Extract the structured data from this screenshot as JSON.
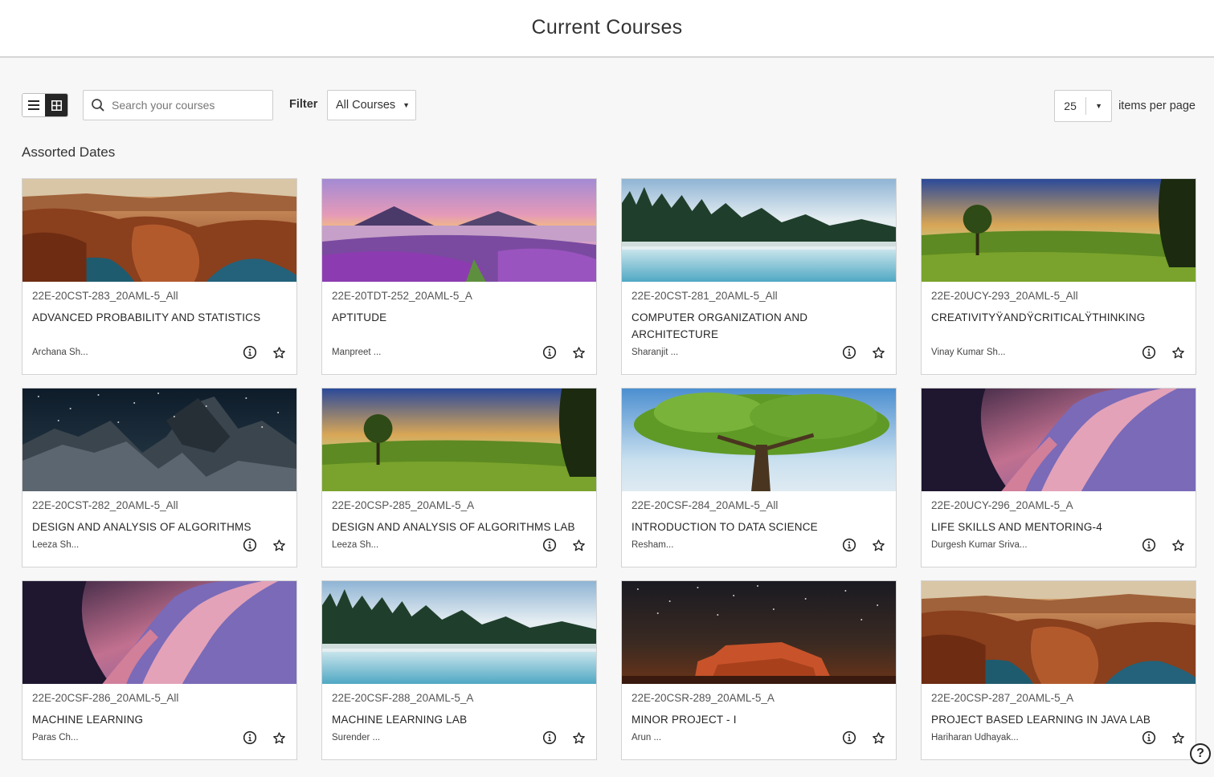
{
  "header": {
    "title": "Current Courses"
  },
  "toolbar": {
    "search_placeholder": "Search your courses",
    "filter_label": "Filter",
    "filter_value": "All Courses",
    "items_per_page_value": "25",
    "items_per_page_label": "items per page"
  },
  "section": {
    "title": "Assorted Dates"
  },
  "courses": [
    {
      "id": "22E-20CST-283_20AML-5_All",
      "title": "ADVANCED PROBABILITY AND STATISTICS",
      "instructor": "Archana Sh...",
      "image": "canyon"
    },
    {
      "id": "22E-20TDT-252_20AML-5_A",
      "title": "APTITUDE",
      "instructor": "Manpreet ...",
      "image": "lavender-lake"
    },
    {
      "id": "22E-20CST-281_20AML-5_All",
      "title": "COMPUTER ORGANIZATION AND ARCHITECTURE",
      "instructor": "Sharanjit ...",
      "image": "misty-forest-lake"
    },
    {
      "id": "22E-20UCY-293_20AML-5_All",
      "title": "CREATIVITYÿANDÿCRITICALÿTHINKING",
      "instructor": "Vinay Kumar Sh...",
      "image": "sunset-meadow"
    },
    {
      "id": "22E-20CST-282_20AML-5_All",
      "title": "DESIGN AND ANALYSIS OF ALGORITHMS",
      "instructor": "Leeza Sh...",
      "image": "night-mountains"
    },
    {
      "id": "22E-20CSP-285_20AML-5_A",
      "title": "DESIGN AND ANALYSIS OF ALGORITHMS LAB",
      "instructor": "Leeza Sh...",
      "image": "sunset-meadow"
    },
    {
      "id": "22E-20CSF-284_20AML-5_All",
      "title": "INTRODUCTION TO DATA SCIENCE",
      "instructor": "Resham...",
      "image": "big-tree"
    },
    {
      "id": "22E-20UCY-296_20AML-5_A",
      "title": "LIFE SKILLS AND MENTORING-4",
      "instructor": "Durgesh Kumar Sriva...",
      "image": "slot-canyon"
    },
    {
      "id": "22E-20CSF-286_20AML-5_All",
      "title": "MACHINE LEARNING",
      "instructor": "Paras Ch...",
      "image": "slot-canyon"
    },
    {
      "id": "22E-20CSF-288_20AML-5_A",
      "title": "MACHINE LEARNING LAB",
      "instructor": "Surender ...",
      "image": "misty-forest-lake"
    },
    {
      "id": "22E-20CSR-289_20AML-5_A",
      "title": "MINOR PROJECT - I",
      "instructor": "Arun ...",
      "image": "red-rock-night"
    },
    {
      "id": "22E-20CSP-287_20AML-5_A",
      "title": "PROJECT BASED LEARNING IN JAVA LAB",
      "instructor": "Hariharan Udhayak...",
      "image": "canyon"
    }
  ],
  "icons": {
    "list_view": "list-view-icon",
    "grid_view": "grid-view-icon",
    "search": "search-icon",
    "info": "info-icon",
    "favorite": "star-icon",
    "help": "help-icon"
  },
  "help": {
    "label": "?"
  }
}
